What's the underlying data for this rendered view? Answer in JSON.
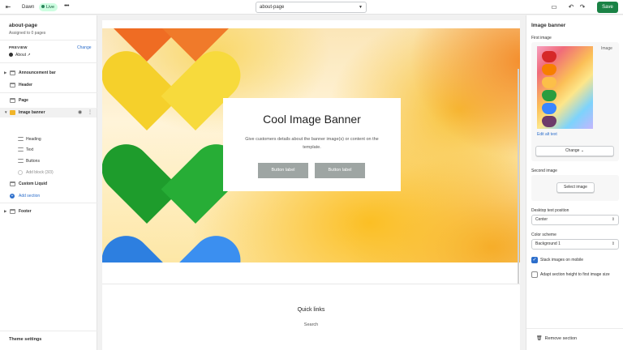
{
  "topbar": {
    "theme_name": "Dawn",
    "live_badge": "Live",
    "template_select": "about-page",
    "save_label": "Save"
  },
  "left_panel": {
    "title": "about-page",
    "subtitle": "Assigned to 0 pages",
    "preview_label": "PREVIEW",
    "preview_change": "Change",
    "preview_value": "About",
    "tree": {
      "announcement_bar": "Announcement bar",
      "header": "Header",
      "page": "Page",
      "image_banner": "Image banner",
      "heading": "Heading",
      "text": "Text",
      "buttons": "Buttons",
      "add_block": "Add block (3/3)",
      "custom_liquid": "Custom Liquid",
      "add_section": "Add section",
      "footer": "Footer"
    },
    "theme_settings": "Theme settings"
  },
  "canvas": {
    "banner_title": "Cool Image Banner",
    "banner_text": "Give customers details about the banner image(s) or content on the template.",
    "button_1": "Button label",
    "button_2": "Button label",
    "quick_links_title": "Quick links",
    "quick_links_item": "Search"
  },
  "right_panel": {
    "title": "Image banner",
    "first_image_label": "First image",
    "first_image_tag": "Image",
    "edit_alt_text": "Edit alt text",
    "change_button": "Change",
    "second_image_label": "Second image",
    "select_image_button": "Select image",
    "desktop_text_position_label": "Desktop text position",
    "desktop_text_position_value": "Center",
    "color_scheme_label": "Color scheme",
    "color_scheme_value": "Background 1",
    "stack_images_label": "Stack images on mobile",
    "stack_images_checked": true,
    "adapt_height_label": "Adapt section height to first image size",
    "adapt_height_checked": false,
    "remove_section": "Remove section"
  },
  "colors": {
    "save_green": "#1a8245",
    "link_blue": "#2c6ecb",
    "banner_button_gray": "#9ea5a3"
  }
}
